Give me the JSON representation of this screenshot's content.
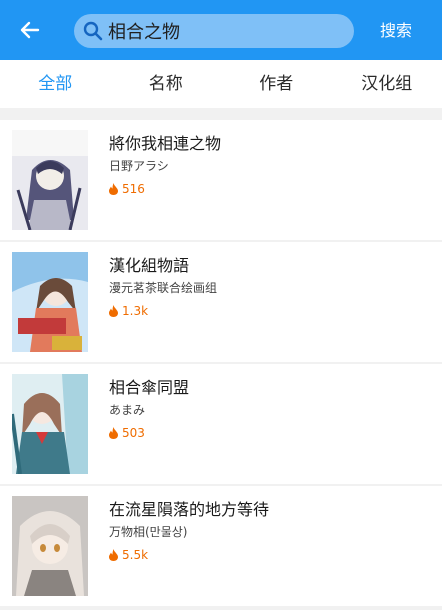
{
  "appbar": {
    "search_value": "相合之物",
    "search_button": "搜索",
    "color": "#2196f3"
  },
  "tabs": [
    {
      "label": "全部",
      "active": true
    },
    {
      "label": "名称",
      "active": false
    },
    {
      "label": "作者",
      "active": false
    },
    {
      "label": "汉化组",
      "active": false
    }
  ],
  "results": [
    {
      "title": "將你我相連之物",
      "author": "日野アラシ",
      "heat": "516"
    },
    {
      "title": "漢化組物語",
      "author": "漫元茗茶联合绘画组",
      "heat": "1.3k"
    },
    {
      "title": "相合傘同盟",
      "author": "あまみ",
      "heat": "503"
    },
    {
      "title": "在流星隕落的地方等待",
      "author": "万物相(만물상)",
      "heat": "5.5k"
    }
  ],
  "icons": {
    "back": "arrow-back-icon",
    "search": "search-icon",
    "heat": "fire-icon"
  },
  "colors": {
    "accent": "#2196f3",
    "heat": "#ef6c00"
  }
}
